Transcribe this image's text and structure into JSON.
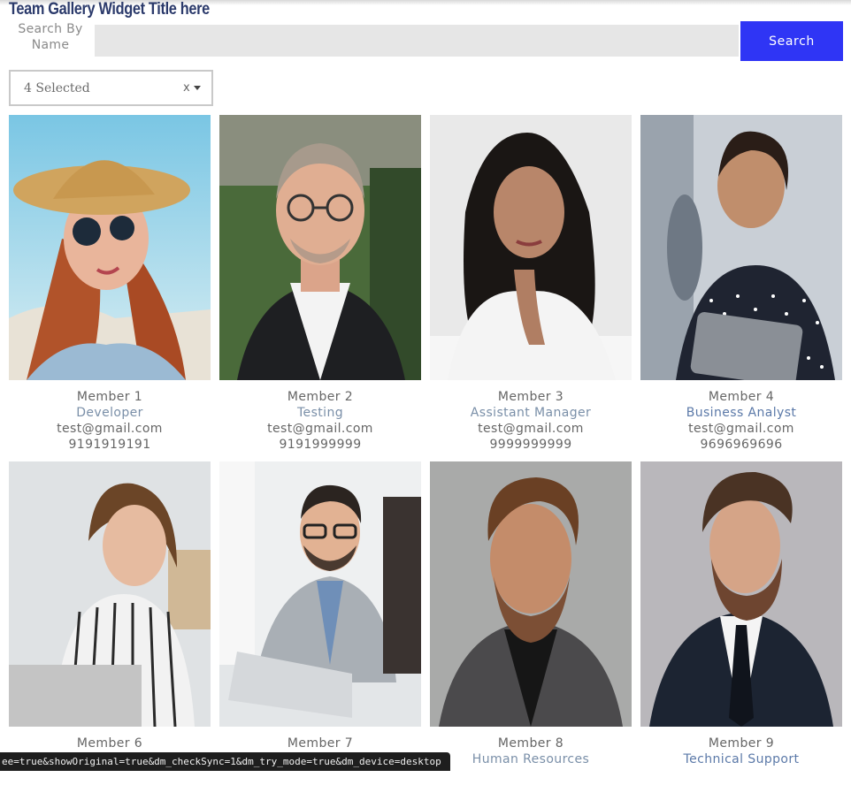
{
  "widget": {
    "title": "Team Gallery Widget Title here"
  },
  "search": {
    "label": "Search By Name",
    "value": "",
    "placeholder": "",
    "button_label": "Search"
  },
  "filter": {
    "selected_text": "4 Selected",
    "clear_label": "x"
  },
  "members": [
    {
      "name": "Member 1",
      "role": "Developer",
      "email": "test@gmail.com",
      "phone": "9191919191"
    },
    {
      "name": "Member 2",
      "role": "Testing",
      "email": "test@gmail.com",
      "phone": "9191999999"
    },
    {
      "name": "Member 3",
      "role": "Assistant Manager",
      "email": "test@gmail.com",
      "phone": "9999999999"
    },
    {
      "name": "Member 4",
      "role": "Business Analyst",
      "email": "test@gmail.com",
      "phone": "9696969696"
    },
    {
      "name": "Member 6",
      "role": "",
      "email": "",
      "phone": ""
    },
    {
      "name": "Member 7",
      "role": "",
      "email": "",
      "phone": ""
    },
    {
      "name": "Member 8",
      "role": "Human Resources",
      "email": "",
      "phone": ""
    },
    {
      "name": "Member 9",
      "role": "Technical Support",
      "email": "",
      "phone": ""
    }
  ],
  "status_bar": {
    "url_text": "ee=true&showOriginal=true&dm_checkSync=1&dm_try_mode=true&dm_device=desktop"
  },
  "colors": {
    "title": "#2b3a6b",
    "button": "#2f35f5",
    "role_text": "#7a8fa8"
  }
}
